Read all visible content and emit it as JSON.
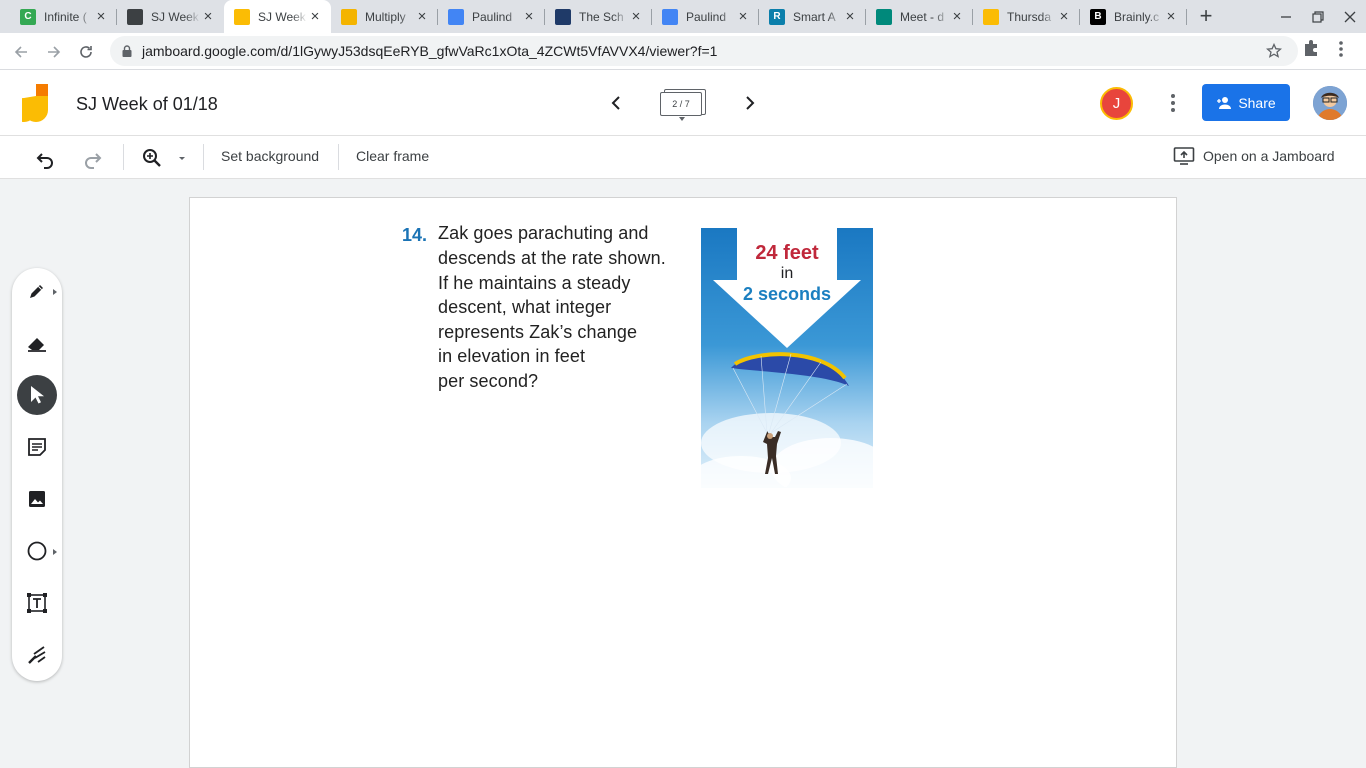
{
  "browser": {
    "tabs": [
      {
        "title": "Infinite (",
        "favicon": "c-green-icon",
        "color": "#34a853",
        "glyph": "C"
      },
      {
        "title": "SJ Week",
        "favicon": "contact-card-icon",
        "color": "#3c4043",
        "glyph": ""
      },
      {
        "title": "SJ Week",
        "favicon": "jamboard-icon",
        "color": "#fbbc04",
        "glyph": "",
        "active": true
      },
      {
        "title": "Multiply",
        "favicon": "slides-icon",
        "color": "#f4b400",
        "glyph": ""
      },
      {
        "title": "Paulind",
        "favicon": "docs-icon",
        "color": "#4285f4",
        "glyph": ""
      },
      {
        "title": "The Sch",
        "favicon": "schoology-icon",
        "color": "#1f3a68",
        "glyph": ""
      },
      {
        "title": "Paulind",
        "favicon": "docs-icon",
        "color": "#4285f4",
        "glyph": ""
      },
      {
        "title": "Smart A",
        "favicon": "r-icon",
        "color": "#0b7fab",
        "glyph": "R"
      },
      {
        "title": "Meet - d",
        "favicon": "meet-icon",
        "color": "#00897b",
        "glyph": ""
      },
      {
        "title": "Thursda",
        "favicon": "jamboard-icon",
        "color": "#fbbc04",
        "glyph": ""
      },
      {
        "title": "Brainly.c",
        "favicon": "brainly-icon",
        "color": "#000000",
        "glyph": "B"
      }
    ],
    "url": "jamboard.google.com/d/1lGywyJ53dsqEeRYB_gfwVaRc1xOta_4ZCWt5VfAVVX4/viewer?f=1"
  },
  "jamboard": {
    "title": "SJ Week of 01/18",
    "frame_indicator": "2 / 7",
    "avatar_letter": "J",
    "share_label": "Share",
    "toolbar": {
      "set_background": "Set background",
      "clear_frame": "Clear frame",
      "open_on_jamboard": "Open on a Jamboard"
    }
  },
  "content": {
    "problem_number": "14.",
    "problem_lines": [
      "Zak goes parachuting and",
      "descends at the rate shown.",
      "If he maintains a steady",
      "descent, what integer",
      "represents Zak’s change",
      "in elevation in feet",
      "per second?"
    ],
    "image_labels": {
      "distance": "24 feet",
      "connector": "in",
      "time": "2 seconds"
    }
  },
  "colors": {
    "accent": "#1a73e8",
    "problem_number": "#1a73b5",
    "label_red": "#c0283b",
    "label_blue": "#1b7fc0"
  }
}
